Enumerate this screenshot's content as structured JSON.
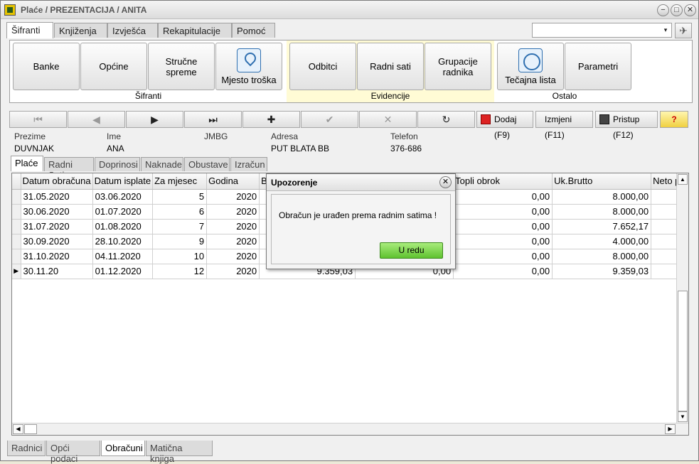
{
  "window": {
    "title": "Plaće / PREZENTACIJA / ANITA",
    "minimize": "−",
    "restore": "□",
    "close": "✕"
  },
  "main_tabs": [
    "Šifranti",
    "Knjiženja",
    "Izvješća",
    "Rekapitulacije",
    "Pomoć"
  ],
  "combo": {
    "value": "",
    "arrow": "▾"
  },
  "ribbon": {
    "sifranti": {
      "label": "Šifranti",
      "buttons": [
        "Banke",
        "Općine",
        "Stručne spreme",
        "Mjesto troška"
      ]
    },
    "evidencije": {
      "label": "Evidencije",
      "buttons": [
        "Odbitci",
        "Radni sati",
        "Grupacije radnika"
      ]
    },
    "ostalo": {
      "label": "Ostalo",
      "buttons": [
        "Tečajna lista",
        "Parametri"
      ]
    },
    "evidencije_color": "#fffbd5"
  },
  "nav": {
    "first": "⏮",
    "prev": "◀",
    "next": "▶",
    "last": "⏭",
    "add": "✚",
    "confirm": "✔",
    "cancel": "✕",
    "refresh": "↻"
  },
  "actions": {
    "dodaj": "Dodaj (F9)",
    "izmjeni": "Izmjeni (F11)",
    "pristup": "Pristup (F12)",
    "help": "?"
  },
  "employee": {
    "prezime_label": "Prezime",
    "prezime": "DUVNJAK",
    "ime_label": "Ime",
    "ime": "ANA",
    "jmbg_label": "JMBG",
    "jmbg": "",
    "adresa_label": "Adresa",
    "adresa": "PUT BLATA BB",
    "telefon_label": "Telefon",
    "telefon": "376-686"
  },
  "sub_tabs": [
    "Plaće",
    "Radni Sati",
    "Doprinosi",
    "Naknade",
    "Obustave",
    "Izračun"
  ],
  "grid": {
    "columns": [
      "Datum obračuna",
      "Datum isplate",
      "Za mjesec",
      "Godina",
      "Br",
      "",
      "Topli obrok",
      "Uk.Brutto",
      "Neto p"
    ],
    "rows": [
      [
        "31.05.2020",
        "03.06.2020",
        "5",
        "2020",
        "",
        "",
        "0,00",
        "8.000,00",
        ""
      ],
      [
        "30.06.2020",
        "01.07.2020",
        "6",
        "2020",
        "",
        "",
        "0,00",
        "8.000,00",
        ""
      ],
      [
        "31.07.2020",
        "01.08.2020",
        "7",
        "2020",
        "",
        "",
        "0,00",
        "7.652,17",
        ""
      ],
      [
        "30.09.2020",
        "28.10.2020",
        "9",
        "2020",
        "",
        "",
        "0,00",
        "4.000,00",
        ""
      ],
      [
        "31.10.2020",
        "04.11.2020",
        "10",
        "2020",
        "",
        "",
        "0,00",
        "8.000,00",
        ""
      ],
      [
        "30.11.20",
        "01.12.2020",
        "12",
        "2020",
        "9.359,03",
        "0,00",
        "0,00",
        "9.359,03",
        ""
      ]
    ],
    "current_row_marker": "▶"
  },
  "bottom_tabs": [
    "Radnici",
    "Opći podaci",
    "Obračuni",
    "Matična knjiga"
  ],
  "dialog": {
    "title": "Upozorenje",
    "message": "Obračun je urađen prema radnim satima !",
    "ok": "U redu",
    "close": "✕"
  }
}
